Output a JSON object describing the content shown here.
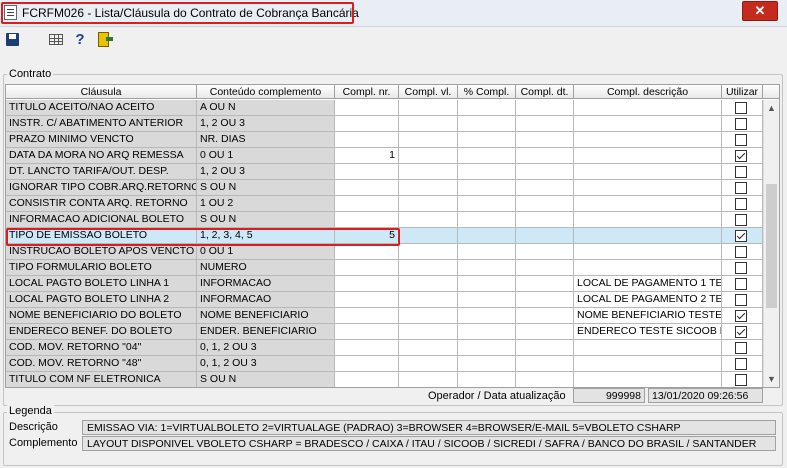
{
  "window": {
    "title": "FCRFM026 - Lista/Cláusula do Contrato de Cobrança Bancária",
    "close_label": "✕"
  },
  "toolbar": {
    "help_label": "?"
  },
  "contrato": {
    "label": "Contrato",
    "columns": [
      "Cláusula",
      "Conteúdo complemento",
      "Compl. nr.",
      "Compl. vl.",
      "% Compl.",
      "Compl. dt.",
      "Compl. descrição",
      "Utilizar"
    ],
    "rows": [
      {
        "clausula": "TITULO ACEITO/NAO ACEITO",
        "conteudo": "A OU N",
        "nr": "",
        "descricao": "",
        "utilizar": false
      },
      {
        "clausula": "INSTR. C/ ABATIMENTO ANTERIOR",
        "conteudo": "1, 2 OU 3",
        "nr": "",
        "descricao": "",
        "utilizar": false
      },
      {
        "clausula": "PRAZO MINIMO VENCTO",
        "conteudo": "NR. DIAS",
        "nr": "",
        "descricao": "",
        "utilizar": false
      },
      {
        "clausula": "DATA DA MORA NO ARQ REMESSA",
        "conteudo": "0 OU 1",
        "nr": "1",
        "descricao": "",
        "utilizar": true
      },
      {
        "clausula": "DT. LANCTO TARIFA/OUT. DESP.",
        "conteudo": "1, 2 OU 3",
        "nr": "",
        "descricao": "",
        "utilizar": false
      },
      {
        "clausula": "IGNORAR TIPO COBR.ARQ.RETORNO",
        "conteudo": "S OU N",
        "nr": "",
        "descricao": "",
        "utilizar": false
      },
      {
        "clausula": "CONSISTIR CONTA ARQ. RETORNO",
        "conteudo": "1 OU 2",
        "nr": "",
        "descricao": "",
        "utilizar": false
      },
      {
        "clausula": "INFORMACAO ADICIONAL BOLETO",
        "conteudo": "S OU N",
        "nr": "",
        "descricao": "",
        "utilizar": false
      },
      {
        "clausula": "TIPO DE EMISSAO BOLETO",
        "conteudo": "1, 2,  3, 4, 5",
        "nr": "5",
        "descricao": "",
        "utilizar": true
      },
      {
        "clausula": "INSTRUCAO BOLETO APOS VENCTO",
        "conteudo": "0 OU 1",
        "nr": "",
        "descricao": "",
        "utilizar": false
      },
      {
        "clausula": "TIPO FORMULARIO BOLETO",
        "conteudo": "NUMERO",
        "nr": "",
        "descricao": "",
        "utilizar": false
      },
      {
        "clausula": "LOCAL PAGTO BOLETO LINHA 1",
        "conteudo": "INFORMACAO",
        "nr": "",
        "descricao": "LOCAL DE PAGAMENTO 1 TE",
        "utilizar": false
      },
      {
        "clausula": "LOCAL PAGTO BOLETO LINHA 2",
        "conteudo": "INFORMACAO",
        "nr": "",
        "descricao": "LOCAL DE PAGAMENTO 2 TE",
        "utilizar": false
      },
      {
        "clausula": "NOME BENEFICIARIO DO BOLETO",
        "conteudo": "NOME BENEFICIARIO",
        "nr": "",
        "descricao": "NOME BENEFICIARIO TESTE S",
        "utilizar": true
      },
      {
        "clausula": "ENDERECO BENEF. DO BOLETO",
        "conteudo": "ENDER. BENEFICIARIO",
        "nr": "",
        "descricao": "ENDERECO TESTE SICOOB PA",
        "utilizar": true
      },
      {
        "clausula": "COD. MOV. RETORNO \"04\"",
        "conteudo": "0, 1, 2 OU 3",
        "nr": "",
        "descricao": "",
        "utilizar": false
      },
      {
        "clausula": "COD. MOV. RETORNO \"48\"",
        "conteudo": "0, 1, 2 OU 3",
        "nr": "",
        "descricao": "",
        "utilizar": false
      },
      {
        "clausula": "TITULO COM NF ELETRONICA",
        "conteudo": "S OU N",
        "nr": "",
        "descricao": "",
        "utilizar": false
      }
    ],
    "selected_row_index": 8
  },
  "footer": {
    "operador_label": "Operador / Data atualização",
    "operador": "999998",
    "data": "13/01/2020 09:26:56"
  },
  "legenda": {
    "label": "Legenda",
    "descricao_label": "Descrição",
    "descricao": "EMISSAO VIA: 1=VIRTUALBOLETO 2=VIRTUALAGE (PADRAO) 3=BROWSER 4=BROWSER/E-MAIL  5=VBOLETO CSHARP",
    "complemento_label": "Complemento",
    "complemento": "LAYOUT DISPONIVEL VBOLETO CSHARP = BRADESCO / CAIXA / ITAU / SICOOB / SICREDI / SAFRA / BANCO DO BRASIL / SANTANDER"
  }
}
